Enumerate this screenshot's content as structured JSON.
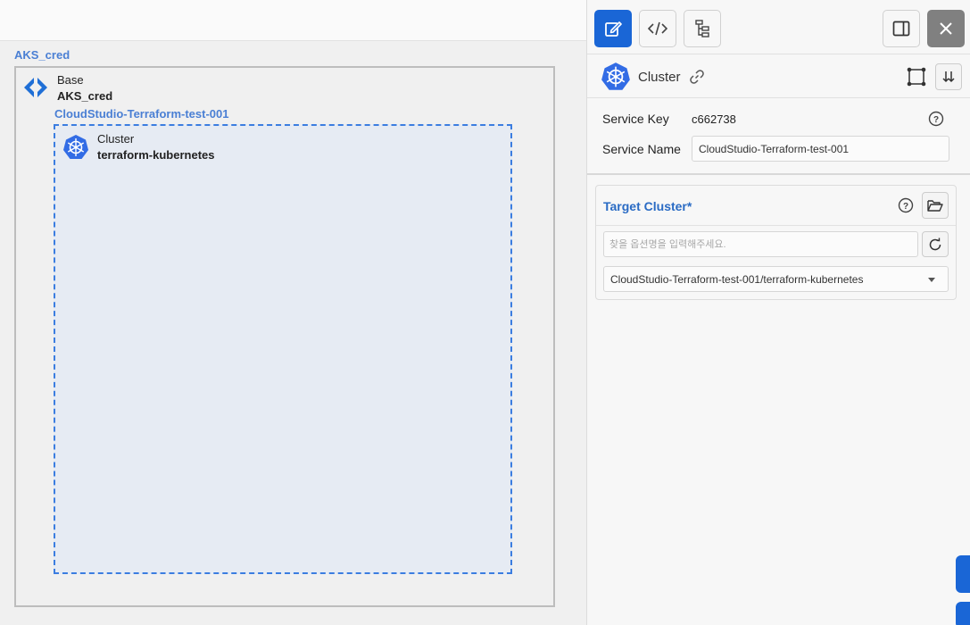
{
  "canvas": {
    "credential_label": "AKS_cred",
    "base": {
      "type": "Base",
      "name": "AKS_cred"
    },
    "service_label": "CloudStudio-Terraform-test-001",
    "cluster": {
      "type": "Cluster",
      "name": "terraform-kubernetes"
    },
    "colors": {
      "accent": "#4a7fd4",
      "cluster_border": "#3b7de0",
      "cluster_fill": "#e6ebf3"
    }
  },
  "toolbar": {
    "icons": [
      "edit-icon",
      "code-icon",
      "tree-icon",
      "panel-toggle-icon",
      "close-icon"
    ]
  },
  "panel": {
    "header_title": "Cluster",
    "service_key_label": "Service Key",
    "service_key_value": "c662738",
    "service_name_label": "Service Name",
    "service_name_value": "CloudStudio-Terraform-test-001",
    "target": {
      "title": "Target Cluster*",
      "search_placeholder": "찾을 옵션명을 입력해주세요.",
      "selected": "CloudStudio-Terraform-test-001/terraform-kubernetes"
    },
    "colors": {
      "primary": "#1a66d6",
      "close": "#808080",
      "title_blue": "#2a6bc4"
    }
  }
}
